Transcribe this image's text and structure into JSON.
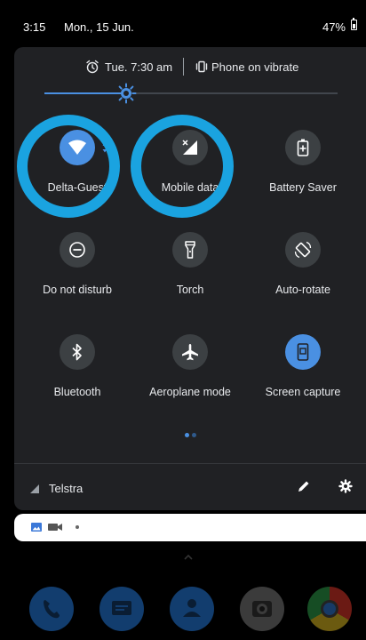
{
  "status_bar": {
    "time": "3:15",
    "date": "Mon., 15 Jun.",
    "battery_percent": "47%",
    "battery_level": 0.47
  },
  "quick_settings": {
    "alarm_text": "Tue. 7:30 am",
    "ringer_text": "Phone on vibrate",
    "brightness_level": 0.28,
    "tiles": [
      {
        "label": "Delta-Guest",
        "icon": "wifi-icon",
        "active": true
      },
      {
        "label": "Mobile data",
        "icon": "mobile-data-off-icon",
        "active": false
      },
      {
        "label": "Battery Saver",
        "icon": "battery-saver-icon",
        "active": false
      },
      {
        "label": "Do not disturb",
        "icon": "do-not-disturb-icon",
        "active": false
      },
      {
        "label": "Torch",
        "icon": "torch-icon",
        "active": false
      },
      {
        "label": "Auto-rotate",
        "icon": "auto-rotate-icon",
        "active": false
      },
      {
        "label": "Bluetooth",
        "icon": "bluetooth-icon",
        "active": false
      },
      {
        "label": "Aeroplane mode",
        "icon": "airplane-icon",
        "active": false
      },
      {
        "label": "Screen capture",
        "icon": "screen-capture-icon",
        "active": true
      }
    ],
    "page_indicator": {
      "current_page": 1,
      "total_pages": 2
    },
    "carrier": "Telstra"
  },
  "notification_strip": {
    "icons": [
      "image-icon",
      "video-camera-icon",
      "more-dot-icon"
    ]
  },
  "dock": {
    "apps": [
      "phone-icon",
      "messages-icon",
      "contacts-icon",
      "camera-icon",
      "chrome-icon"
    ]
  },
  "colors": {
    "accent": "#4a90e2",
    "highlight_ring": "#1aa3e0",
    "panel_bg": "#202124",
    "tile_off_bg": "#3c4043"
  }
}
